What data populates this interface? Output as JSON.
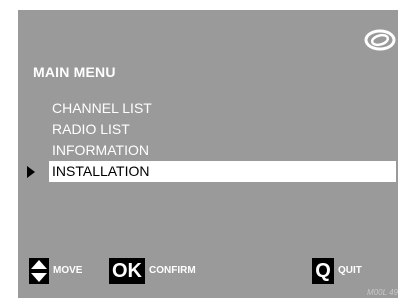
{
  "menu": {
    "title": "MAIN MENU",
    "items": [
      {
        "label": "CHANNEL LIST",
        "selected": false
      },
      {
        "label": "RADIO LIST",
        "selected": false
      },
      {
        "label": "INFORMATION",
        "selected": false
      },
      {
        "label": "INSTALLATION",
        "selected": true
      }
    ]
  },
  "footer": {
    "move": {
      "icon": "up-down-arrows-icon",
      "label": "MOVE"
    },
    "confirm": {
      "icon_text": "OK",
      "label": "CONFIRM"
    },
    "quit": {
      "icon_text": "Q",
      "label": "QUIT"
    }
  },
  "reference": "M00L 49",
  "colors": {
    "background": "#9a9a9a",
    "text": "#ffffff",
    "highlight": "#ffffff"
  }
}
